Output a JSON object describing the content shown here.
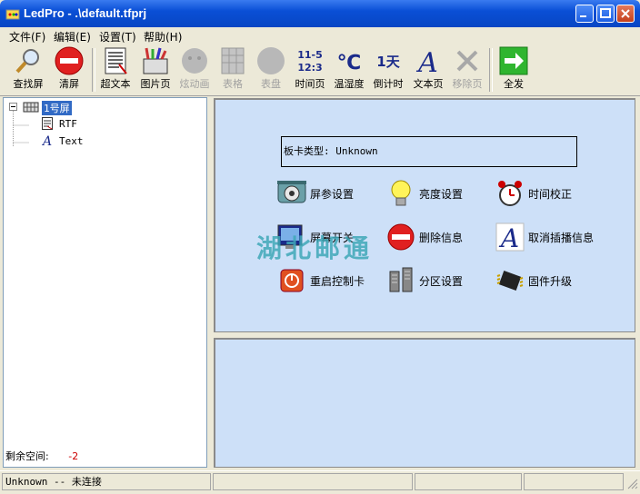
{
  "window": {
    "title": "LedPro - .\\default.tfprj"
  },
  "menu": [
    "文件(F)",
    "编辑(E)",
    "设置(T)",
    "帮助(H)"
  ],
  "toolbar": [
    {
      "label": "查找屏",
      "icon": "magnifier-icon",
      "enabled": true
    },
    {
      "label": "清屏",
      "icon": "no-entry-icon",
      "enabled": true
    },
    {
      "label": "超文本",
      "icon": "hypertext-icon",
      "enabled": true
    },
    {
      "label": "图片页",
      "icon": "picture-page-icon",
      "enabled": true
    },
    {
      "label": "炫动画",
      "icon": "animation-icon",
      "enabled": false
    },
    {
      "label": "表格",
      "icon": "table-icon",
      "enabled": false
    },
    {
      "label": "表盘",
      "icon": "dial-icon",
      "enabled": false
    },
    {
      "label": "时间页",
      "icon": "clock-text-icon",
      "enabled": true,
      "glyph": "11-5\n12:3"
    },
    {
      "label": "温湿度",
      "icon": "celsius-icon",
      "enabled": true,
      "glyph": "℃"
    },
    {
      "label": "倒计时",
      "icon": "countdown-icon",
      "enabled": true,
      "glyph": "1天"
    },
    {
      "label": "文本页",
      "icon": "text-page-icon",
      "enabled": true,
      "glyph": "A"
    },
    {
      "label": "移除页",
      "icon": "remove-icon",
      "enabled": false
    },
    {
      "label": "全发",
      "icon": "send-all-arrow-icon",
      "enabled": true
    }
  ],
  "tree": {
    "root": "1号屏",
    "children": [
      "RTF",
      "Text"
    ]
  },
  "left_footer": {
    "label": "剩余空间:",
    "value": "-2"
  },
  "card_type": "板卡类型: Unknown",
  "actions": [
    {
      "label": "屏参设置",
      "icon": "screen-params-icon"
    },
    {
      "label": "亮度设置",
      "icon": "lightbulb-icon"
    },
    {
      "label": "时间校正",
      "icon": "alarm-clock-icon"
    },
    {
      "label": "屏幕开关",
      "icon": "screen-switch-icon"
    },
    {
      "label": "删除信息",
      "icon": "delete-icon"
    },
    {
      "label": "取消插播信息",
      "icon": "cancel-insert-icon"
    },
    {
      "label": "重启控制卡",
      "icon": "restart-icon"
    },
    {
      "label": "分区设置",
      "icon": "partition-icon"
    },
    {
      "label": "固件升级",
      "icon": "chip-icon"
    }
  ],
  "watermark": "湖北邮通",
  "status": {
    "text": "Unknown -- 未连接"
  },
  "colors": {
    "title_bar": "#0a4fd6",
    "panel_bg": "#cde0f8",
    "selection": "#316ac5",
    "value_red": "#cc0000"
  }
}
